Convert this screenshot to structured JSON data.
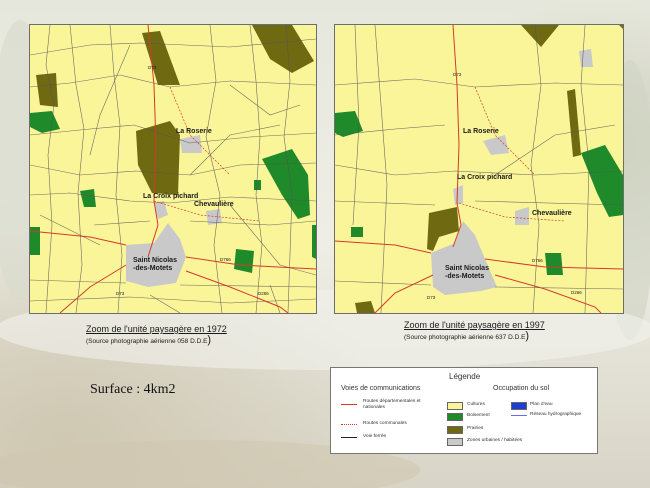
{
  "maps": [
    {
      "id": "1972",
      "caption": "Zoom de l'unité paysagère en 1972",
      "source": "(Source photographie aérienne 058 D.D.E",
      "source_close": ")",
      "places": [
        "La Roserie",
        "La Croix pichard",
        "Chevaulière",
        "Saint Nicolas",
        "-des-Motets"
      ],
      "roads": [
        "D73",
        "D766",
        "D73",
        "D266"
      ]
    },
    {
      "id": "1997",
      "caption": "Zoom de l'unité paysagère en 1997",
      "source": "(Source photographie aérienne 637 D.D.E",
      "source_close": ")",
      "places": [
        "La Roserie",
        "La Croix pichard",
        "Chevaulière",
        "Saint Nicolas",
        "-des-Motets"
      ],
      "roads": [
        "D73",
        "D766",
        "D73",
        "D266"
      ]
    }
  ],
  "surface": "Surface : 4km2",
  "legend": {
    "title": "Légende",
    "comm_title": "Voies de communications",
    "soil_title": "Occupation du sol",
    "items": {
      "routes_dep": "Routes départementales et nationales",
      "routes_com": "Routes communales",
      "voie_ferree": "Voie ferrée",
      "cultures": "Cultures",
      "boisement": "Boisement",
      "prairies": "Prairies",
      "zones": "Zones urbaines / habitées",
      "plan_eau": "Plan d'eau",
      "reseau": "Réseau hydrographique"
    }
  },
  "colors": {
    "cultures": "#fbf59a",
    "boisement": "#1f8a2a",
    "prairies": "#6f6a12",
    "zones": "#c9c9c9",
    "plan_eau": "#1d3fd1",
    "routes": "#d43a2a",
    "reseau": "#6a6af0"
  }
}
